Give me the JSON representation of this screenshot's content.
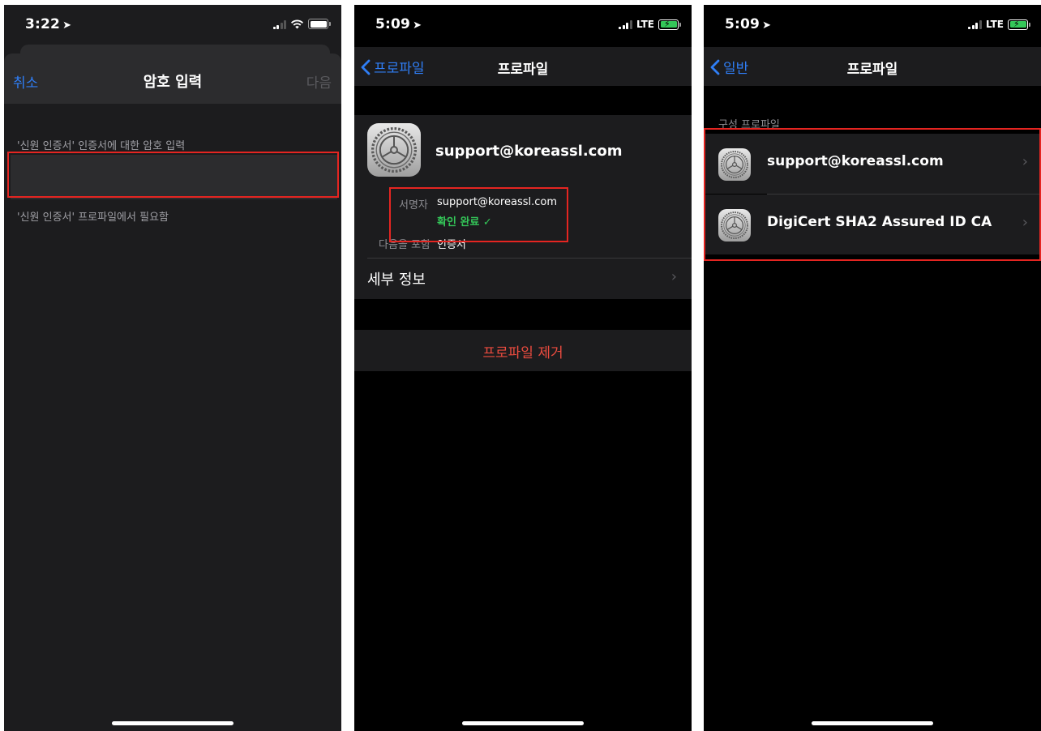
{
  "panel1": {
    "status": {
      "time": "3:22"
    },
    "header": {
      "cancel": "취소",
      "title": "암호 입력",
      "next": "다음"
    },
    "field": {
      "label": "'신원 인증서' 인증서에 대한 암호 입력",
      "value": "",
      "footer": "'신원 인증서' 프로파일에서 필요함"
    }
  },
  "panel2": {
    "status": {
      "time": "5:09",
      "network": "LTE"
    },
    "nav": {
      "back": "프로파일",
      "title": "프로파일"
    },
    "profile": {
      "name": "support@koreassl.com",
      "signer_label": "서명자",
      "signer_value": "support@koreassl.com",
      "verified": "확인 완료 ✓",
      "contains_label": "다음을 포함",
      "contains_value": "인증서"
    },
    "details": {
      "label": "세부 정보"
    },
    "remove": {
      "label": "프로파일 제거"
    }
  },
  "panel3": {
    "status": {
      "time": "5:09",
      "network": "LTE"
    },
    "nav": {
      "back": "일반",
      "title": "프로파일"
    },
    "section": {
      "header": "구성 프로파일"
    },
    "items": [
      {
        "name": "support@koreassl.com"
      },
      {
        "name": "DigiCert SHA2 Assured ID CA"
      }
    ]
  },
  "colors": {
    "accent_blue": "#2f7ef6",
    "highlight_red": "#e52521",
    "verified_green": "#34c759",
    "destructive_red": "#eb4b3f"
  },
  "icons": [
    "location-arrow-icon",
    "signal-icon",
    "wifi-icon",
    "battery-icon",
    "chevron-left-icon",
    "chevron-right-icon",
    "settings-gear-icon",
    "checkmark-icon"
  ]
}
